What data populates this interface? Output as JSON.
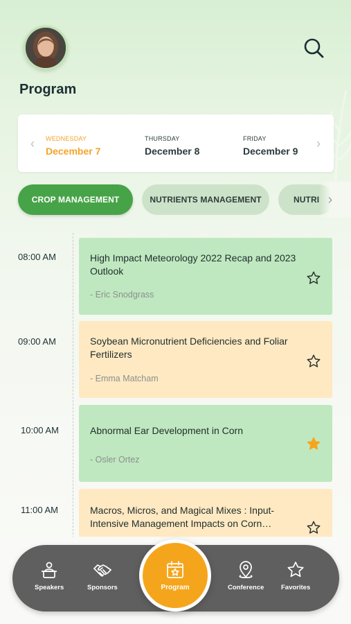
{
  "header": {
    "title": "Program",
    "avatar_icon": "user-avatar",
    "search_icon": "search-icon"
  },
  "dates": [
    {
      "day": "WEDNESDAY",
      "date": "December 7",
      "active": true
    },
    {
      "day": "THURSDAY",
      "date": "December 8",
      "active": false
    },
    {
      "day": "FRIDAY",
      "date": "December 9",
      "active": false
    }
  ],
  "categories": [
    {
      "label": "CROP MANAGEMENT",
      "active": true
    },
    {
      "label": "NUTRIENTS MANAGEMENT",
      "active": false
    },
    {
      "label": "NUTRI",
      "active": false
    }
  ],
  "schedule": [
    {
      "time": "08:00 AM",
      "title": "High Impact Meteorology 2022 Recap and 2023 Outlook",
      "speaker": "- Eric Snodgrass",
      "color": "green",
      "favorite": false
    },
    {
      "time": "09:00 AM",
      "title": "Soybean Micronutrient Deficiencies and Foliar Fertilizers",
      "speaker": "- Emma Matcham",
      "color": "orange",
      "favorite": false
    },
    {
      "time": "10:00 AM",
      "title": "Abnormal Ear Development in Corn",
      "speaker": "- Osler Ortez",
      "color": "green",
      "favorite": true
    },
    {
      "time": "11:00 AM",
      "title": "Macros, Micros, and Magical Mixes : Input-Intensive Management Impacts on Corn…",
      "speaker": "",
      "color": "orange",
      "favorite": false
    }
  ],
  "nav": {
    "items": [
      {
        "label": "Speakers",
        "icon": "speakers-icon"
      },
      {
        "label": "Sponsors",
        "icon": "handshake-icon"
      },
      {
        "label": "Program",
        "icon": "calendar-star-icon",
        "active": true
      },
      {
        "label": "Conference",
        "icon": "location-pin-icon"
      },
      {
        "label": "Favorites",
        "icon": "star-icon"
      }
    ]
  },
  "colors": {
    "accent": "#f5a51c",
    "primary_green": "#47a348",
    "card_green": "#bfe8c0",
    "card_orange": "#ffe9c3",
    "nav_bg": "#5f5f5f"
  }
}
